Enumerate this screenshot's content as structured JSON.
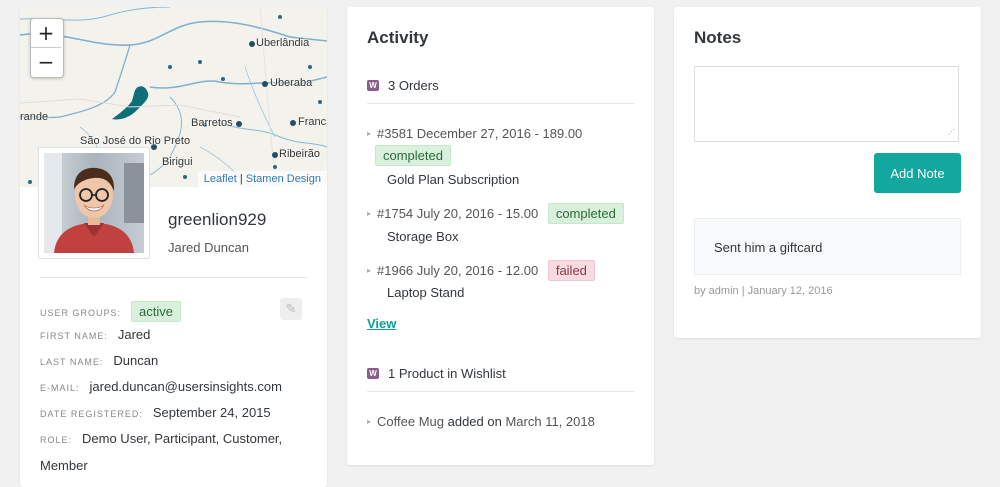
{
  "map": {
    "zoom_in": "+",
    "zoom_out": "−",
    "attribution_1": "Leaflet",
    "attribution_sep": " | ",
    "attribution_2": "Stamen Design",
    "labels": {
      "uberlandia": "Uberlândia",
      "uberaba": "Uberaba",
      "barretos": "Barretos",
      "franca": "Franc",
      "grande": "rande",
      "sjrp": "São José do Rio Preto",
      "birigui": "Birigui",
      "ribeirao": "Ribeirão"
    }
  },
  "profile": {
    "username": "greenlion929",
    "full_name": "Jared Duncan",
    "fields": {
      "user_groups_label": "USER GROUPS:",
      "user_groups_value": "active",
      "first_name_label": "FIRST NAME:",
      "first_name_value": "Jared",
      "last_name_label": "LAST NAME:",
      "last_name_value": "Duncan",
      "email_label": "E-MAIL:",
      "email_value": "jared.duncan@usersinsights.com",
      "date_registered_label": "DATE REGISTERED:",
      "date_registered_value": "September 24, 2015",
      "role_label": "ROLE:",
      "role_value": "Demo User, Participant, Customer, Member"
    }
  },
  "activity": {
    "title": "Activity",
    "orders_heading": "3 Orders",
    "orders": [
      {
        "summary": "#3581 December 27, 2016 - 189.00",
        "status": "completed",
        "item": "Gold Plan Subscription"
      },
      {
        "summary": "#1754 July 20, 2016 - 15.00",
        "status": "completed",
        "item": "Storage Box"
      },
      {
        "summary": "#1966 July 20, 2016 - 12.00",
        "status": "failed",
        "item": "Laptop Stand"
      }
    ],
    "view_link": "View",
    "wishlist_heading": "1 Product in Wishlist",
    "wishlist_item": "Coffee Mug",
    "wishlist_added_on": "added on",
    "wishlist_date": "March 11, 2018",
    "woo_icon_text": "W"
  },
  "notes": {
    "title": "Notes",
    "input_value": "",
    "add_button": "Add Note",
    "note_text": "Sent him a giftcard",
    "note_meta": "by admin | January 12, 2016"
  },
  "colors": {
    "accent": "#12a8a0",
    "badge_green_bg": "#d8f0dc",
    "badge_red_bg": "#f8dbe0",
    "woo_purple": "#8b5b8c"
  }
}
